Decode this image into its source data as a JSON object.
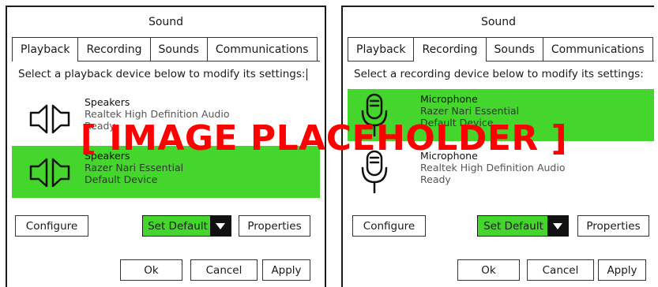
{
  "left_dialog": {
    "title": "Sound",
    "tabs": [
      "Playback",
      "Recording",
      "Sounds",
      "Communications"
    ],
    "active_tab": "Playback",
    "instruction": "Select a playback device below to modify its settings:",
    "devices": [
      {
        "name": "Speakers",
        "driver": "Realtek High Definition Audio",
        "status": "Ready",
        "icon": "speaker-icon",
        "selected": false
      },
      {
        "name": "Speakers",
        "driver": "Razer Nari Essential",
        "status": "Default Device",
        "icon": "speaker-icon",
        "selected": true
      }
    ],
    "buttons": {
      "configure": "Configure",
      "set_default": "Set Default",
      "properties": "Properties",
      "ok": "Ok",
      "cancel": "Cancel",
      "apply": "Apply"
    }
  },
  "right_dialog": {
    "title": "Sound",
    "tabs": [
      "Playback",
      "Recording",
      "Sounds",
      "Communications"
    ],
    "active_tab": "Recording",
    "instruction": "Select a recording device below to modify its settings:",
    "devices": [
      {
        "name": "Microphone",
        "driver": "Razer Nari Essential",
        "status": "Default Device",
        "icon": "microphone-icon",
        "selected": true
      },
      {
        "name": "Microphone",
        "driver": "Realtek High Definition Audio",
        "status": "Ready",
        "icon": "microphone-icon",
        "selected": false
      }
    ],
    "buttons": {
      "configure": "Configure",
      "set_default": "Set Default",
      "properties": "Properties",
      "ok": "Ok",
      "cancel": "Cancel",
      "apply": "Apply"
    }
  },
  "overlay": {
    "text": "[ IMAGE PLACEHOLDER ]"
  },
  "colors": {
    "accent_green": "#44d62c",
    "placeholder_red": "#ff0000"
  }
}
